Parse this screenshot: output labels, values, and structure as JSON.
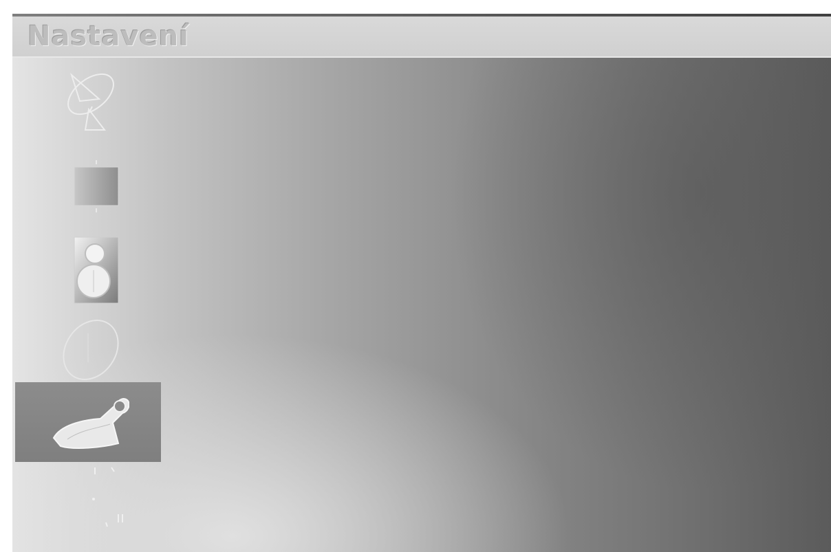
{
  "window": {
    "title": "Nastavení"
  },
  "menu": {
    "items": [
      {
        "icon": "satellite-dish-icon",
        "selected": false
      },
      {
        "icon": "picture-icon",
        "selected": false
      },
      {
        "icon": "speaker-icon",
        "selected": false
      },
      {
        "icon": "clock-icon",
        "selected": false
      },
      {
        "icon": "lock-key-icon",
        "selected": true
      },
      {
        "icon": "misc-settings-icon",
        "selected": false
      }
    ]
  },
  "colors": {
    "title_text": "#bdbdbd",
    "selected_bg": "#858585",
    "icon_stroke": "#ededed"
  }
}
